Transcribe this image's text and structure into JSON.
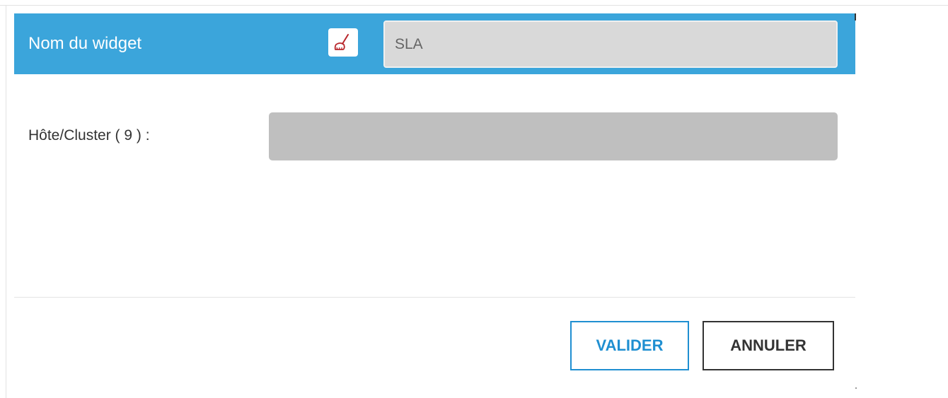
{
  "header": {
    "title": "Nom du widget",
    "widget_name_value": "SLA",
    "brush_icon": "broom-icon",
    "accent_color": "#3ba5db"
  },
  "form": {
    "host_cluster_label": "Hôte/Cluster ( 9 ) :",
    "host_cluster_value": ""
  },
  "footer": {
    "validate_label": "VALIDER",
    "cancel_label": "ANNULER",
    "validate_color": "#1f8fd1"
  }
}
